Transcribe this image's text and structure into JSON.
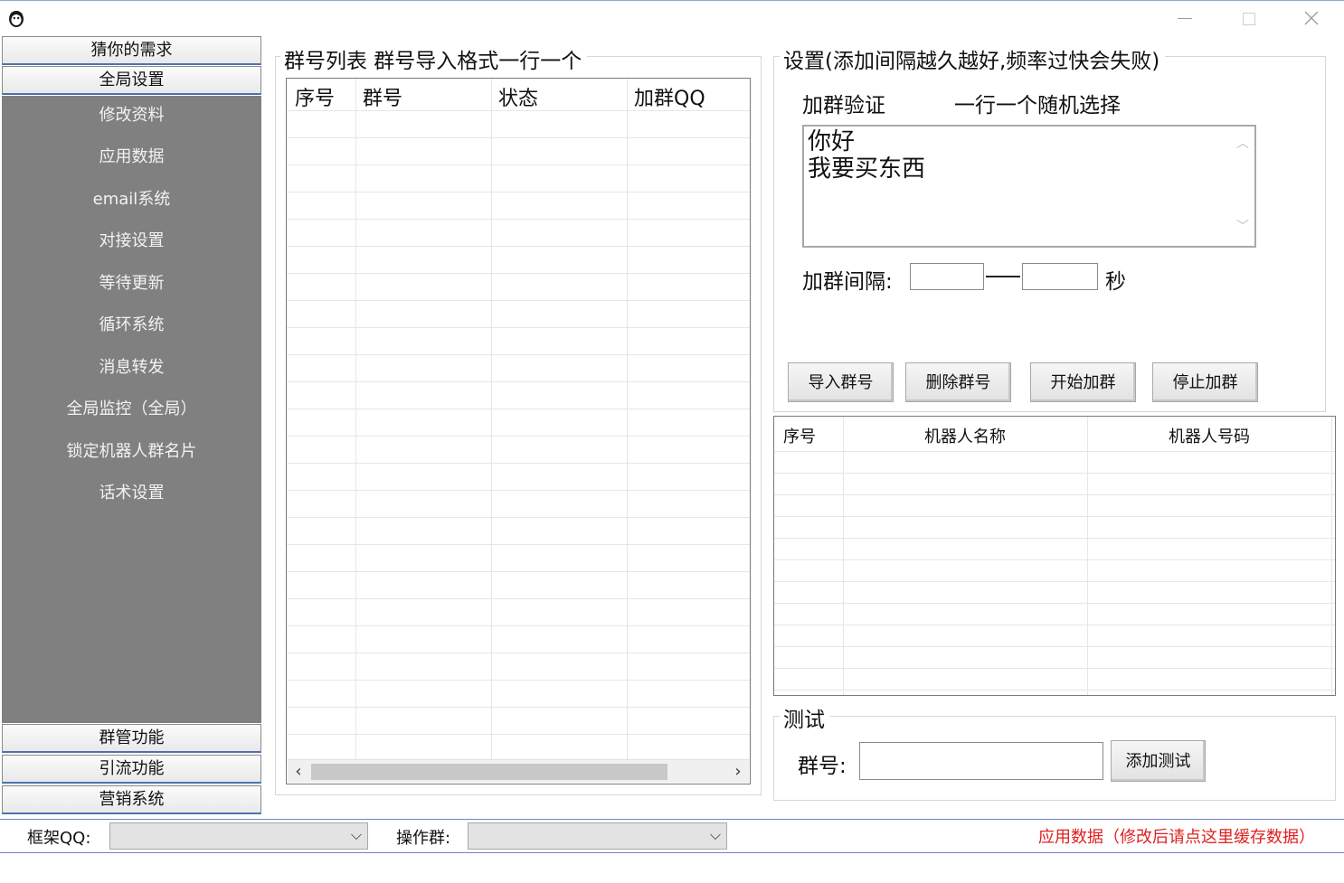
{
  "nav": {
    "headers_top": [
      "猜你的需求",
      "全局设置"
    ],
    "items": [
      "修改资料",
      "应用数据",
      "email系统",
      "对接设置",
      "等待更新",
      "循环系统",
      "消息转发",
      "全局监控（全局）",
      "锁定机器人群名片",
      "话术设置"
    ],
    "headers_bottom": [
      "群管功能",
      "引流功能",
      "营销系统"
    ]
  },
  "group_list": {
    "title": "群号列表 群号导入格式一行一个",
    "columns": [
      "序号",
      "群号",
      "状态",
      "加群QQ"
    ]
  },
  "settings": {
    "title": "设置(添加间隔越久越好,频率过快会失败)",
    "verify_label": "加群验证",
    "verify_hint": "一行一个随机选择",
    "verify_lines": [
      "你好",
      "我要买东西"
    ],
    "interval_label": "加群间隔:",
    "interval_unit": "秒",
    "buttons": [
      "导入群号",
      "删除群号",
      "开始加群",
      "停止加群"
    ]
  },
  "robot_table": {
    "columns": [
      "序号",
      "机器人名称",
      "机器人号码"
    ]
  },
  "test": {
    "title": "测试",
    "group_label": "群号:",
    "add_button": "添加测试"
  },
  "footer": {
    "frame_label": "框架QQ:",
    "op_label": "操作群:",
    "apply_link": "应用数据（修改后请点这里缓存数据）"
  },
  "colors": {
    "nav_bg": "#808080",
    "link_red": "#e02020",
    "accent_blue": "#4a72b0"
  }
}
